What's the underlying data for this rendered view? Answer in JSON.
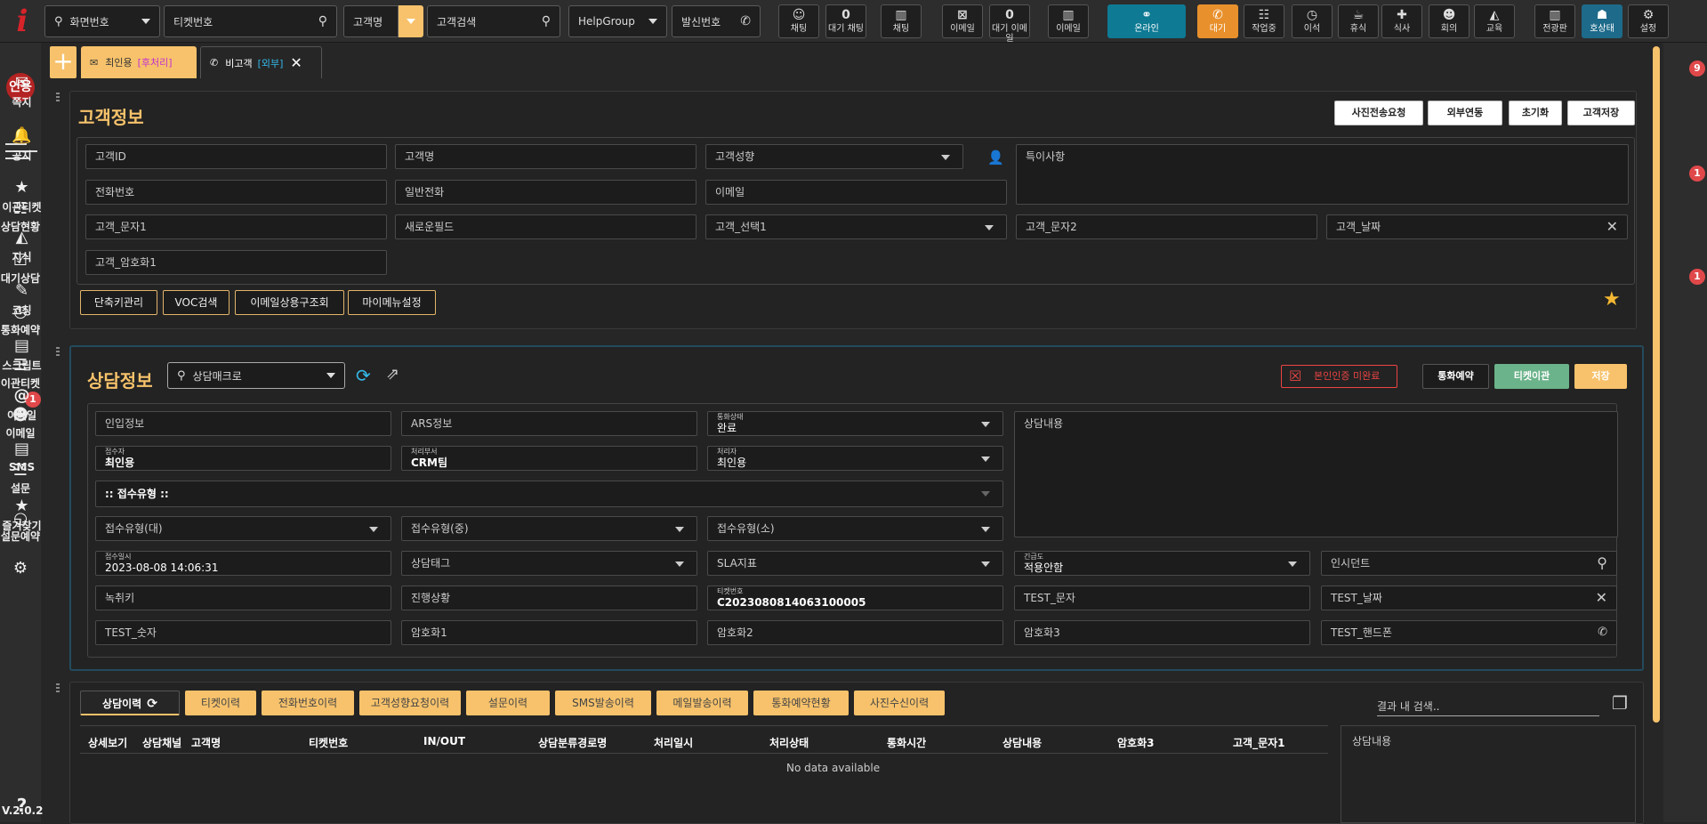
{
  "topbar": {
    "screen_no": "화면번호",
    "ticket_no": "티켓번호",
    "cust_name": "고객명",
    "cust_search": "고객검색",
    "helpgroup": "HelpGroup",
    "caller_no": "발신번호",
    "buttons": [
      {
        "label": "채팅",
        "top": "",
        "icon": "chat-icon"
      },
      {
        "label": "대기 채팅",
        "top": "0",
        "icon": ""
      },
      {
        "label": "채팅",
        "top": "",
        "icon": "chart-icon"
      },
      {
        "label": "이메일",
        "top": "",
        "icon": "mail-off-icon"
      },
      {
        "label": "대기 이메일",
        "top": "0",
        "icon": ""
      },
      {
        "label": "이메일",
        "top": "",
        "icon": "chart-icon"
      },
      {
        "label": "온라인",
        "top": "",
        "icon": "link-icon"
      },
      {
        "label": "대기",
        "top": "",
        "icon": "phone-icon"
      },
      {
        "label": "작업중",
        "top": "",
        "icon": "work-icon"
      },
      {
        "label": "이석",
        "top": "",
        "icon": "away-icon"
      },
      {
        "label": "휴식",
        "top": "",
        "icon": "coffee-icon"
      },
      {
        "label": "식사",
        "top": "",
        "icon": "meal-icon"
      },
      {
        "label": "회의",
        "top": "",
        "icon": "meeting-icon"
      },
      {
        "label": "교육",
        "top": "",
        "icon": "education-icon"
      },
      {
        "label": "전광판",
        "top": "",
        "icon": "chart-icon"
      },
      {
        "label": "호상태",
        "top": "",
        "icon": "person-icon"
      },
      {
        "label": "설정",
        "top": "",
        "icon": "gear-icon"
      }
    ]
  },
  "tabs": {
    "t1_label": "최인용",
    "t1_tag": "[후처리]",
    "t2_label": "비고객",
    "t2_tag": "[외부]"
  },
  "leftnav": {
    "avatar": "인용",
    "items": [
      "상담현황",
      "대기상담",
      "통화예약",
      "이관티켓",
      "이메일",
      "설문",
      "설문예약"
    ],
    "email_badge": "1",
    "version": "V.2.0.2"
  },
  "rightnav": {
    "items": [
      "쪽지",
      "공지",
      "이관티켓",
      "지식",
      "코칭",
      "스크립트",
      "이메일",
      "SMS",
      "즐겨찾기"
    ],
    "badges": {
      "note": "9",
      "ticket": "1",
      "coaching": "1"
    }
  },
  "customer": {
    "title": "고객정보",
    "actions": [
      "사진전송요청",
      "외부연동",
      "초기화",
      "고객저장"
    ],
    "fields": {
      "id": "고객ID",
      "name": "고객명",
      "grade": "고객성향",
      "notes": "특이사항",
      "phone": "전화번호",
      "tel": "일반전화",
      "email": "이메일",
      "text1": "고객_문자1",
      "newfield": "새로운필드",
      "select1": "고객_선택1",
      "text2": "고객_문자2",
      "date": "고객_날짜",
      "enc1": "고객_암호화1"
    },
    "bottom_buttons": [
      "단축키관리",
      "VOC검색",
      "이메일상용구조회",
      "마이메뉴설정"
    ]
  },
  "consult": {
    "title": "상담정보",
    "macro": "상담매크로",
    "auth": "본인인증 미완료",
    "reserve": "통화예약",
    "transfer": "티켓이관",
    "save": "저장",
    "inbound": "인입정보",
    "ars": "ARS정보",
    "call_state_cap": "통화상태",
    "call_state": "완료",
    "content": "상담내용",
    "receiver_cap": "접수자",
    "receiver": "최인용",
    "dept_cap": "처리부서",
    "dept": "CRM팀",
    "handler_cap": "처리자",
    "handler": "최인용",
    "rtype": ":: 접수유형 ::",
    "rtype_l": "접수유형(대)",
    "rtype_m": "접수유형(중)",
    "rtype_s": "접수유형(소)",
    "rtime_cap": "접수일시",
    "rtime": "2023-08-08 14:06:31",
    "tag": "상담태그",
    "sla": "SLA지표",
    "urgency_cap": "긴급도",
    "urgency": "적용안함",
    "incident": "인시던트",
    "recordkey": "녹취키",
    "progress": "진행상황",
    "ticket_cap": "티켓번호",
    "ticket": "C2023080814063100005",
    "test_text": "TEST_문자",
    "test_date": "TEST_날짜",
    "test_num": "TEST_숫자",
    "enc1": "암호화1",
    "enc2": "암호화2",
    "enc3": "암호화3",
    "test_phone": "TEST_핸드폰"
  },
  "history": {
    "tabs": [
      "상담이력",
      "티켓이력",
      "전화번호이력",
      "고객성향요청이력",
      "설문이력",
      "SMS발송이력",
      "메일발송이력",
      "통화예약현황",
      "사진수신이력"
    ],
    "search_placeholder": "결과 내 검색..",
    "columns": [
      "상세보기",
      "상담채널",
      "고객명",
      "티켓번호",
      "IN/OUT",
      "상담분류경로명",
      "처리일시",
      "처리상태",
      "통화시간",
      "상담내용",
      "암호화3",
      "고객_문자1"
    ],
    "empty": "No data available",
    "side_label": "상담내용"
  },
  "colors": {
    "accent": "#f7c26b",
    "brand": "#d8232a",
    "online": "#0e7a94",
    "wait": "#e8902c"
  }
}
